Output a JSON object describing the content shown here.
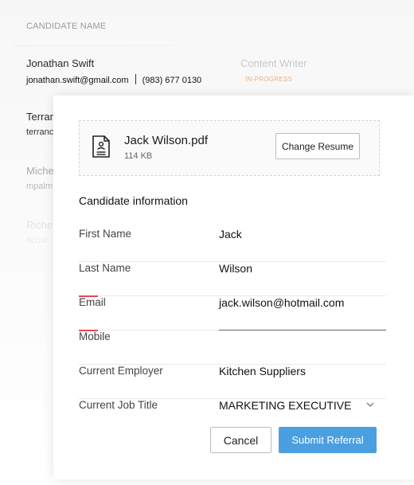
{
  "background_list": {
    "header": "CANDIDATE NAME",
    "rows": [
      {
        "name": "Jonathan Swift",
        "email": "jonathan.swift@gmail.com",
        "phone": "(983) 677 0130",
        "role": "Content Writer",
        "status": "IN-PROGRESS"
      },
      {
        "name": "Terran",
        "email": "terranc"
      },
      {
        "name": "Miche",
        "email": "mpalm"
      },
      {
        "name": "Riche",
        "email": "richar"
      }
    ]
  },
  "modal": {
    "resume": {
      "file_name": "Jack Wilson.pdf",
      "file_size": "114 KB",
      "change_label": "Change Resume",
      "icon": "document-icon"
    },
    "section_title": "Candidate information",
    "fields": {
      "first_name": {
        "label": "First Name",
        "value": "Jack"
      },
      "last_name": {
        "label": "Last Name",
        "value": "Wilson"
      },
      "email": {
        "label": "Email",
        "value": "jack.wilson@hotmail.com"
      },
      "mobile": {
        "label": "Mobile",
        "value": ""
      },
      "current_employer": {
        "label": "Current Employer",
        "value": "Kitchen Suppliers"
      },
      "current_job_title": {
        "label": "Current Job Title",
        "value": "MARKETING EXECUTIVE"
      }
    },
    "cancel_label": "Cancel",
    "submit_label": "Submit Referral"
  },
  "colors": {
    "accent_blue": "#4a9fe1",
    "required_red": "#e5495b",
    "status_orange": "#e9b07b"
  }
}
